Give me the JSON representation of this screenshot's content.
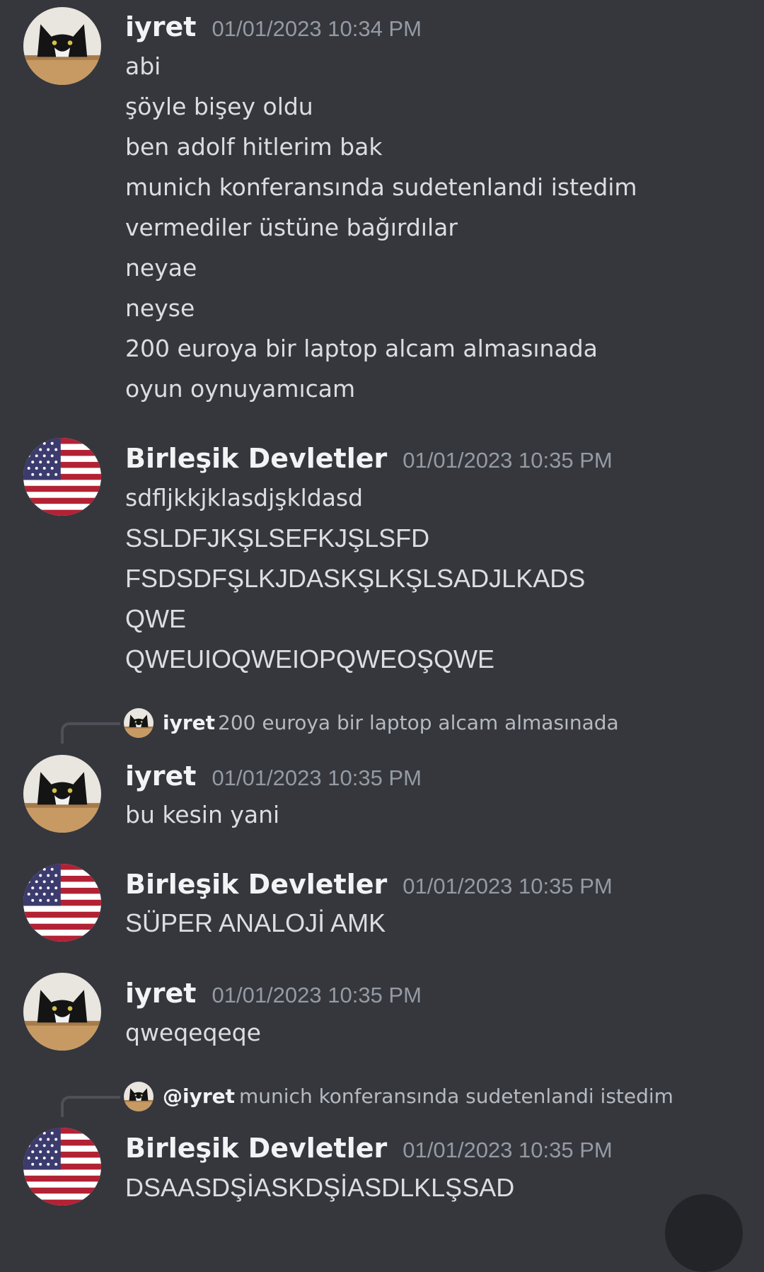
{
  "messages": [
    {
      "username": "iyret",
      "timestamp": "01/01/2023 10:34 PM",
      "avatar": "cat-avatar",
      "lines": [
        "abi",
        "şöyle bişey oldu",
        "ben adolf hitlerim bak",
        "munich konferansında sudetenlandi istedim",
        "vermediler üstüne bağırdılar",
        "neyae",
        "neyse",
        "200 euroya bir laptop alcam almasınada",
        "oyun oynuyamıcam"
      ]
    },
    {
      "username": "Birleşik Devletler",
      "timestamp": "01/01/2023 10:35 PM",
      "avatar": "us-flag-avatar",
      "lines": [
        "sdfljkkjklasdjşkldasd",
        "SSLDFJKŞLSEFKJŞLSFD",
        "FSDSDFŞLKJDASKŞLKŞLSADJLKADS",
        "QWE",
        "QWEUIOQWEIOPQWEOŞQWE"
      ]
    },
    {
      "reply": {
        "name": "iyret",
        "text": "200 euroya bir laptop alcam almasınada"
      },
      "username": "iyret",
      "timestamp": "01/01/2023 10:35 PM",
      "avatar": "cat-avatar",
      "lines": [
        "bu kesin yani"
      ]
    },
    {
      "username": "Birleşik Devletler",
      "timestamp": "01/01/2023 10:35 PM",
      "avatar": "us-flag-avatar",
      "lines": [
        "SÜPER ANALOJİ AMK"
      ]
    },
    {
      "username": "iyret",
      "timestamp": "01/01/2023 10:35 PM",
      "avatar": "cat-avatar",
      "lines": [
        "qweqeqeqe"
      ]
    },
    {
      "reply": {
        "name": "@iyret",
        "text": "munich konferansında sudetenlandi istedim"
      },
      "username": "Birleşik Devletler",
      "timestamp": "01/01/2023 10:35 PM",
      "avatar": "us-flag-avatar",
      "lines": [
        "DSAASDŞİASKDŞİASDLKLŞSAD"
      ]
    }
  ],
  "colors": {
    "background": "#36373d",
    "username": "#f2f3f5",
    "timestamp": "#949ba4",
    "message_text": "#dbdee1",
    "reply_text": "#b5bac1"
  }
}
